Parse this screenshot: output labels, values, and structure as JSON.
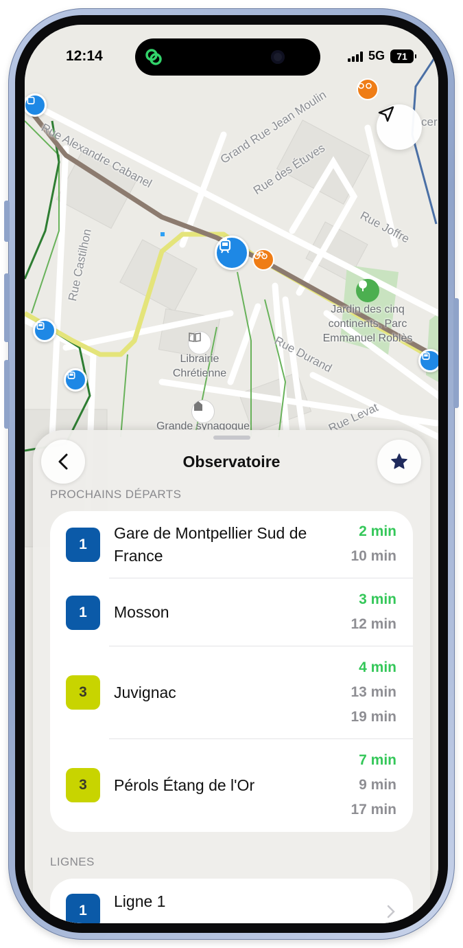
{
  "status_bar": {
    "time": "12:14",
    "network": "5G",
    "battery": "71"
  },
  "map": {
    "streets": [
      "Rue Alexandre Cabanel",
      "Grand Rue Jean Moulin",
      "Rue des Étuves",
      "Rue Joffre",
      "Rue Castilhon",
      "Rue Durand",
      "Rue Levat"
    ],
    "pois": {
      "park": "Jardin des cinq continents, Parc Emmanuel Roblès",
      "bookstore": "Librairie Chrétienne",
      "synagogue": "Grande synagogue"
    },
    "edge_label": "cer"
  },
  "sheet": {
    "title": "Observatoire",
    "departures_header": "PROCHAINS DÉPARTS",
    "lines_header": "LIGNES",
    "departures": [
      {
        "line": "1",
        "line_color": "#0b5aa8",
        "text_color": "#ffffff",
        "destination": "Gare de Montpellier Sud de France",
        "times": [
          "2 min",
          "10 min"
        ]
      },
      {
        "line": "1",
        "line_color": "#0b5aa8",
        "text_color": "#ffffff",
        "destination": "Mosson",
        "times": [
          "3 min",
          "12 min"
        ]
      },
      {
        "line": "3",
        "line_color": "#c8d400",
        "text_color": "#3a3a2a",
        "destination": "Juvignac",
        "times": [
          "4 min",
          "13 min",
          "19 min"
        ]
      },
      {
        "line": "3",
        "line_color": "#c8d400",
        "text_color": "#3a3a2a",
        "destination": "Pérols Étang de l'Or",
        "times": [
          "7 min",
          "9 min",
          "17 min"
        ]
      }
    ],
    "lines": [
      {
        "line": "1",
        "label": "Ligne 1"
      }
    ]
  },
  "colors": {
    "accent_green": "#34c759",
    "tram_blue": "#1e88e5",
    "bike_orange": "#ef7d16",
    "star_navy": "#1f2a5c"
  }
}
